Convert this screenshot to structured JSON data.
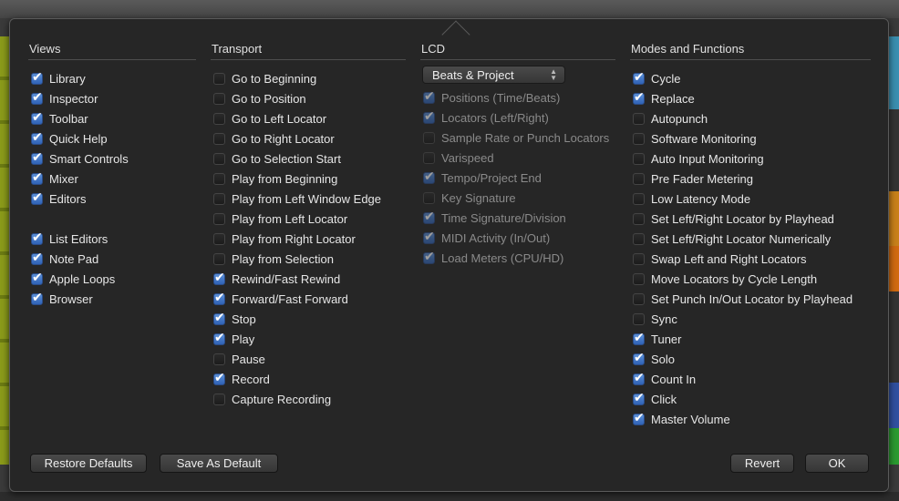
{
  "views": {
    "title": "Views",
    "items": [
      {
        "label": "Library",
        "checked": true
      },
      {
        "label": "Inspector",
        "checked": true
      },
      {
        "label": "Toolbar",
        "checked": true
      },
      {
        "label": "Quick Help",
        "checked": true
      },
      {
        "label": "Smart Controls",
        "checked": true
      },
      {
        "label": "Mixer",
        "checked": true
      },
      {
        "label": "Editors",
        "checked": true
      },
      null,
      {
        "label": "List Editors",
        "checked": true
      },
      {
        "label": "Note Pad",
        "checked": true
      },
      {
        "label": "Apple Loops",
        "checked": true
      },
      {
        "label": "Browser",
        "checked": true
      }
    ]
  },
  "transport": {
    "title": "Transport",
    "items": [
      {
        "label": "Go to Beginning",
        "checked": false
      },
      {
        "label": "Go to Position",
        "checked": false
      },
      {
        "label": "Go to Left Locator",
        "checked": false
      },
      {
        "label": "Go to Right Locator",
        "checked": false
      },
      {
        "label": "Go to Selection Start",
        "checked": false
      },
      {
        "label": "Play from Beginning",
        "checked": false
      },
      {
        "label": "Play from Left Window Edge",
        "checked": false
      },
      {
        "label": "Play from Left Locator",
        "checked": false
      },
      {
        "label": "Play from Right Locator",
        "checked": false
      },
      {
        "label": "Play from Selection",
        "checked": false
      },
      {
        "label": "Rewind/Fast Rewind",
        "checked": true
      },
      {
        "label": "Forward/Fast Forward",
        "checked": true
      },
      {
        "label": "Stop",
        "checked": true
      },
      {
        "label": "Play",
        "checked": true
      },
      {
        "label": "Pause",
        "checked": false
      },
      {
        "label": "Record",
        "checked": true
      },
      {
        "label": "Capture Recording",
        "checked": false
      }
    ]
  },
  "lcd": {
    "title": "LCD",
    "mode": "Beats & Project",
    "items": [
      {
        "label": "Positions (Time/Beats)",
        "checked": true
      },
      {
        "label": "Locators (Left/Right)",
        "checked": true
      },
      {
        "label": "Sample Rate or Punch Locators",
        "checked": false
      },
      {
        "label": "Varispeed",
        "checked": false
      },
      {
        "label": "Tempo/Project End",
        "checked": true
      },
      {
        "label": "Key Signature",
        "checked": false
      },
      {
        "label": "Time Signature/Division",
        "checked": true
      },
      {
        "label": "MIDI Activity (In/Out)",
        "checked": true
      },
      {
        "label": "Load Meters (CPU/HD)",
        "checked": true
      }
    ]
  },
  "modes": {
    "title": "Modes and Functions",
    "items": [
      {
        "label": "Cycle",
        "checked": true
      },
      {
        "label": "Replace",
        "checked": true
      },
      {
        "label": "Autopunch",
        "checked": false
      },
      {
        "label": "Software Monitoring",
        "checked": false
      },
      {
        "label": "Auto Input Monitoring",
        "checked": false
      },
      {
        "label": "Pre Fader Metering",
        "checked": false
      },
      {
        "label": "Low Latency Mode",
        "checked": false
      },
      {
        "label": "Set Left/Right Locator by Playhead",
        "checked": false
      },
      {
        "label": "Set Left/Right Locator Numerically",
        "checked": false
      },
      {
        "label": "Swap Left and Right Locators",
        "checked": false
      },
      {
        "label": "Move Locators by Cycle Length",
        "checked": false
      },
      {
        "label": "Set Punch In/Out Locator by Playhead",
        "checked": false
      },
      {
        "label": "Sync",
        "checked": false
      },
      {
        "label": "Tuner",
        "checked": true
      },
      {
        "label": "Solo",
        "checked": true
      },
      {
        "label": "Count In",
        "checked": true
      },
      {
        "label": "Click",
        "checked": true
      },
      {
        "label": "Master Volume",
        "checked": true
      }
    ]
  },
  "buttons": {
    "restore": "Restore Defaults",
    "save": "Save As Default",
    "revert": "Revert",
    "ok": "OK"
  }
}
